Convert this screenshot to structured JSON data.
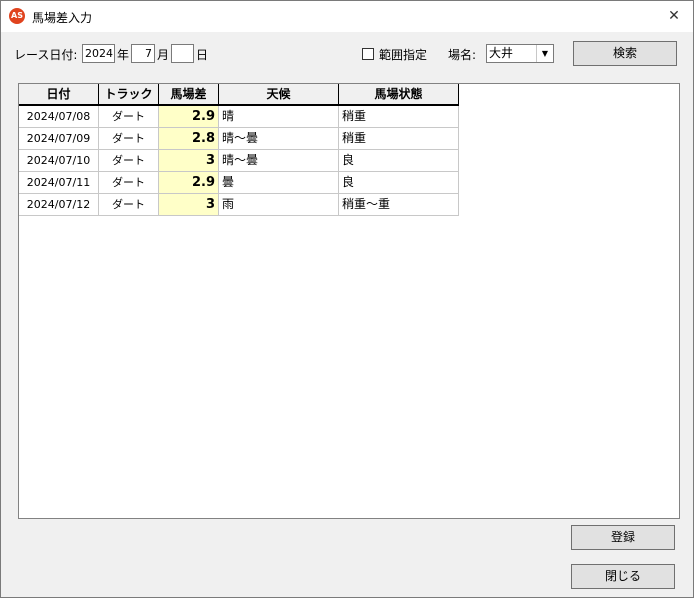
{
  "window": {
    "title": "馬場差入力",
    "app_icon_text": "AS",
    "close_glyph": "✕"
  },
  "filters": {
    "race_date_label": "レース日付:",
    "year": "2024",
    "year_unit": "年",
    "month": "7",
    "month_unit": "月",
    "day": "",
    "day_unit": "日",
    "range_label": "範囲指定",
    "range_checked": false,
    "venue_label": "場名:",
    "venue": "大井",
    "search_label": "検索"
  },
  "grid": {
    "columns": [
      "日付",
      "トラック",
      "馬場差",
      "天候",
      "馬場状態"
    ],
    "rows": [
      {
        "date": "2024/07/08",
        "track": "ダート",
        "diff": "2.9",
        "weather": "晴",
        "condition": "稍重"
      },
      {
        "date": "2024/07/09",
        "track": "ダート",
        "diff": "2.8",
        "weather": "晴～曇",
        "condition": "稍重"
      },
      {
        "date": "2024/07/10",
        "track": "ダート",
        "diff": "3",
        "weather": "晴～曇",
        "condition": "良"
      },
      {
        "date": "2024/07/11",
        "track": "ダート",
        "diff": "2.9",
        "weather": "曇",
        "condition": "良"
      },
      {
        "date": "2024/07/12",
        "track": "ダート",
        "diff": "3",
        "weather": "雨",
        "condition": "稍重～重"
      }
    ]
  },
  "buttons": {
    "register_label": "登録",
    "close_label": "閉じる"
  }
}
